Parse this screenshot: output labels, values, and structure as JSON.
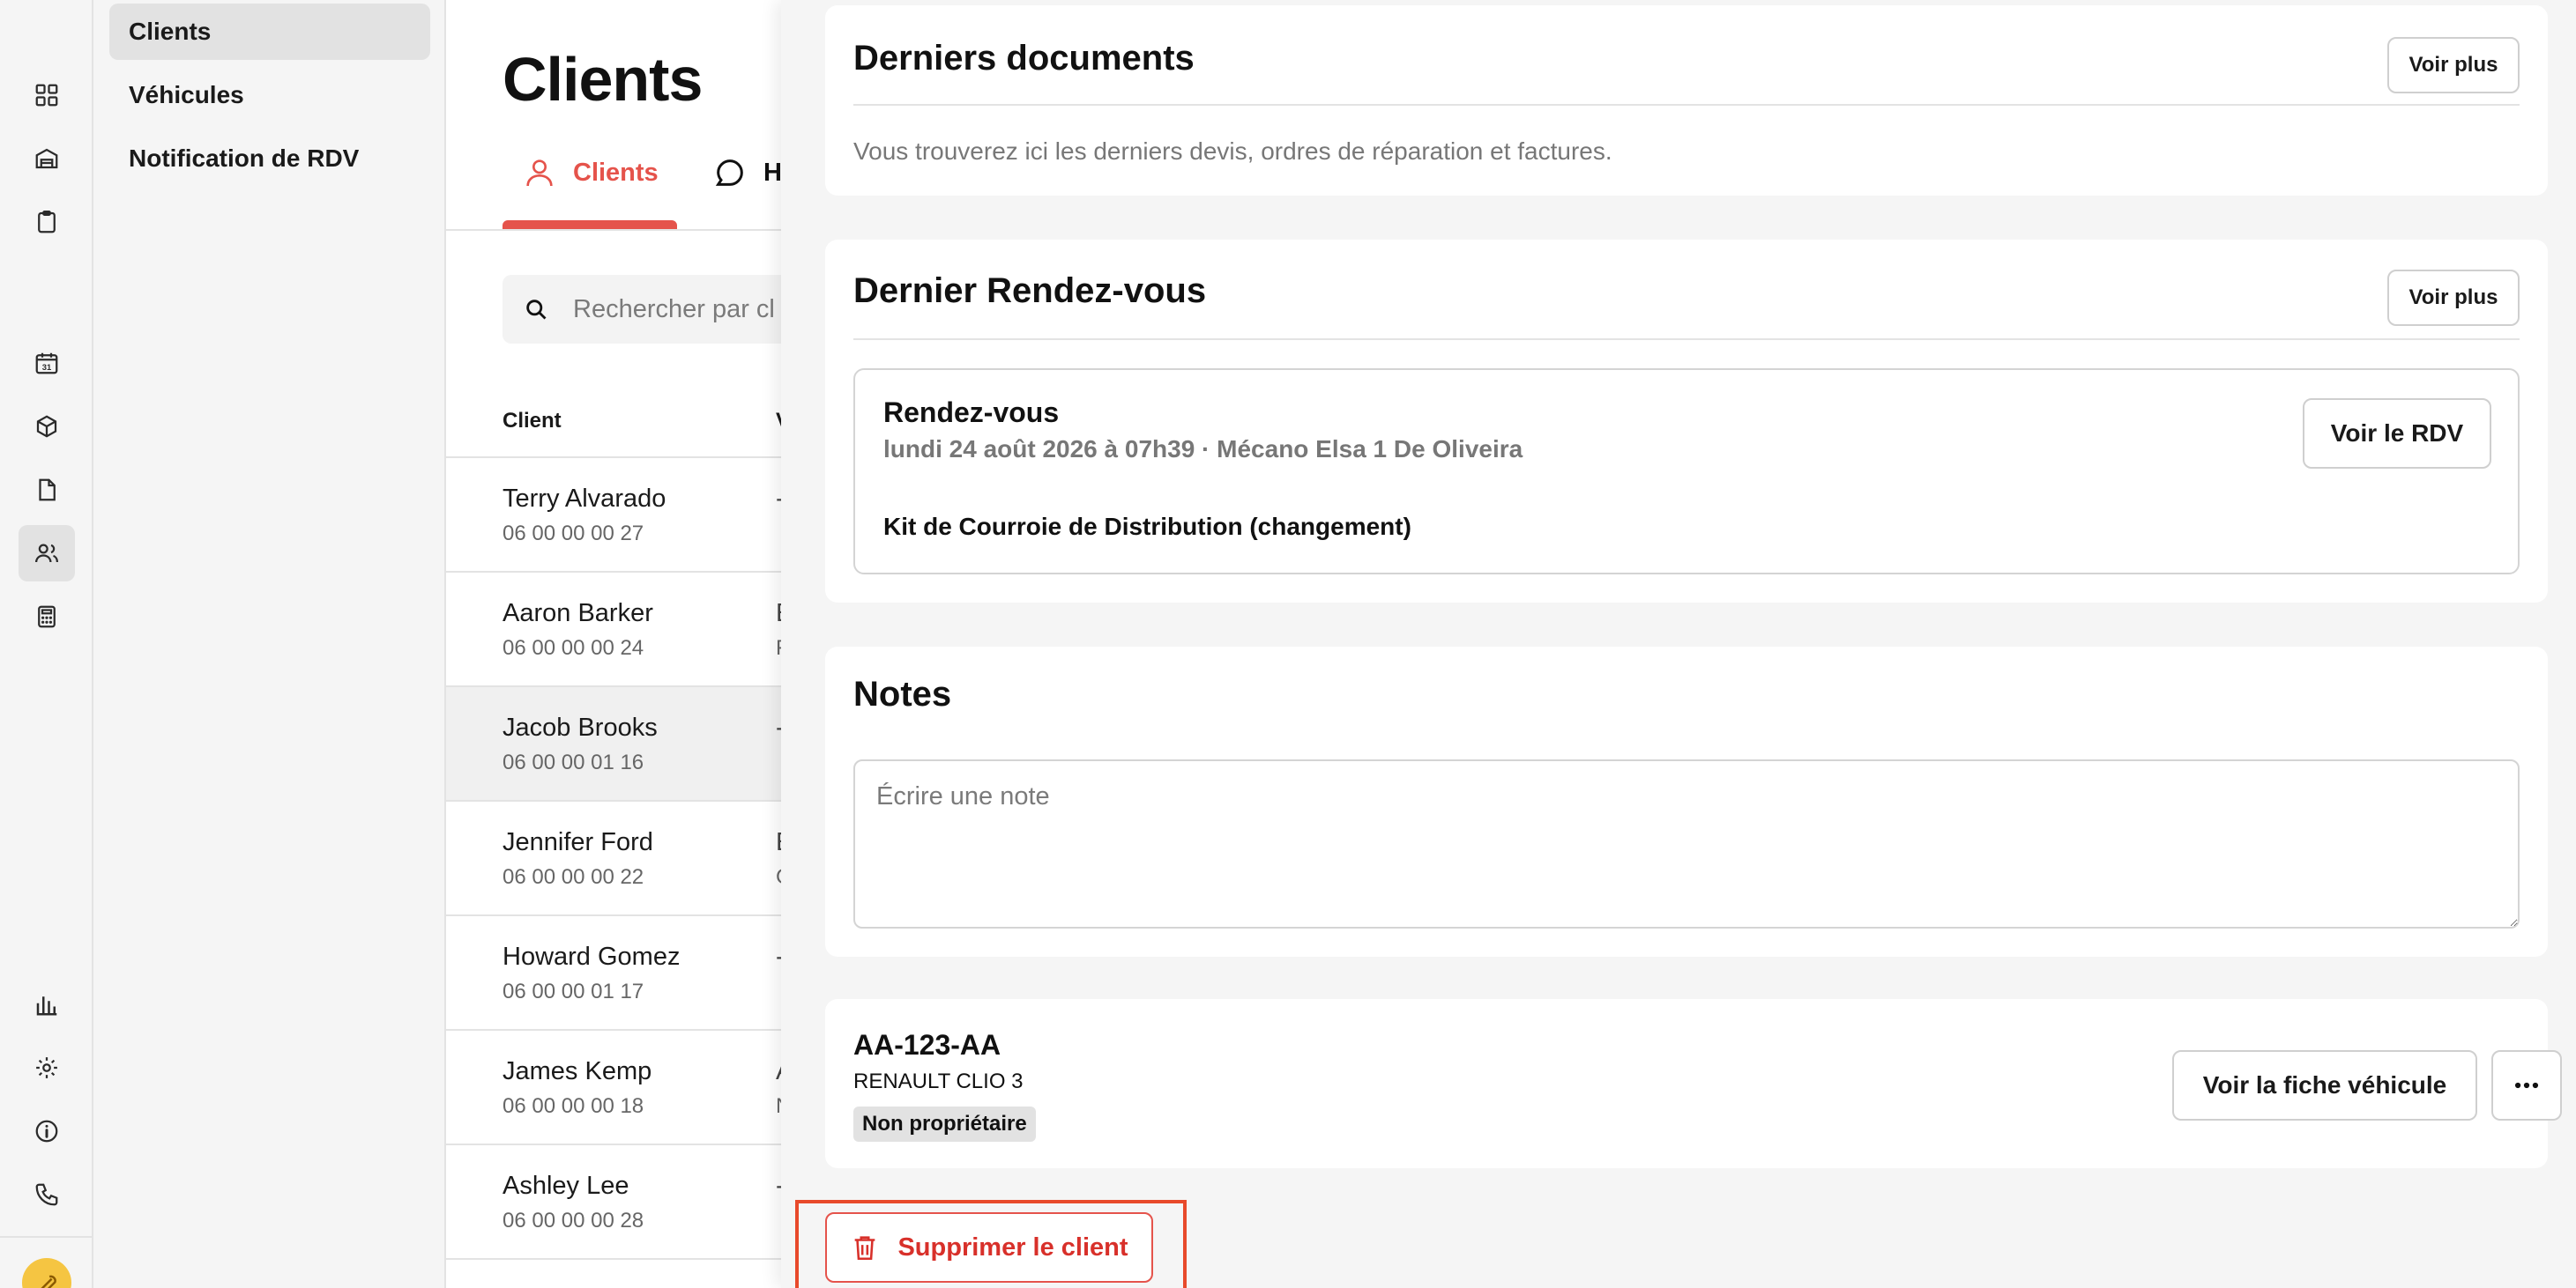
{
  "subnav": {
    "items": [
      {
        "label": "Clients",
        "active": true
      },
      {
        "label": "Véhicules",
        "active": false
      },
      {
        "label": "Notification de RDV",
        "active": false
      }
    ]
  },
  "rail": {
    "icons": [
      "dashboard-icon",
      "garage-icon",
      "clipboard-icon",
      "calendar-icon",
      "box-icon",
      "document-icon",
      "users-icon",
      "calculator-icon",
      "chart-icon",
      "gear-icon",
      "info-icon",
      "phone-icon",
      "wrench-avatar-icon"
    ],
    "active": "users-icon",
    "calendar_day": "31"
  },
  "list": {
    "title": "Clients",
    "tabs": [
      {
        "label": "Clients",
        "active": true
      },
      {
        "label": "Hi",
        "active": false
      }
    ],
    "search_placeholder": "Rechercher par cl",
    "columns": {
      "client": "Client",
      "vehicle": "V"
    },
    "rows": [
      {
        "name": "Terry Alvarado",
        "phone": "06 00 00 00 27",
        "vehicle": "-",
        "sub": ""
      },
      {
        "name": "Aaron Barker",
        "phone": "06 00 00 00 24",
        "vehicle": "E",
        "sub": "F"
      },
      {
        "name": "Jacob Brooks",
        "phone": "06 00 00 01 16",
        "vehicle": "-",
        "sub": "",
        "selected": true
      },
      {
        "name": "Jennifer Ford",
        "phone": "06 00 00 00 22",
        "vehicle": "E",
        "sub": "C"
      },
      {
        "name": "Howard Gomez",
        "phone": "06 00 00 01 17",
        "vehicle": "-",
        "sub": ""
      },
      {
        "name": "James Kemp",
        "phone": "06 00 00 00 18",
        "vehicle": "A",
        "sub": "N"
      },
      {
        "name": "Ashley Lee",
        "phone": "06 00 00 00 28",
        "vehicle": "-",
        "sub": ""
      }
    ]
  },
  "drawer": {
    "documents": {
      "title": "Derniers documents",
      "more_label": "Voir plus",
      "description": "Vous trouverez ici les derniers devis, ordres de réparation et factures."
    },
    "appointment": {
      "title": "Dernier Rendez-vous",
      "more_label": "Voir plus",
      "card_title": "Rendez-vous",
      "card_subtitle": "lundi 24 août 2026 à 07h39 · Mécano Elsa 1 De Oliveira",
      "service": "Kit de Courroie de Distribution (changement)",
      "view_label": "Voir le RDV"
    },
    "notes": {
      "title": "Notes",
      "placeholder": "Écrire une note",
      "value": ""
    },
    "vehicle": {
      "plate": "AA-123-AA",
      "model": "RENAULT CLIO 3",
      "badge": "Non propriétaire",
      "view_label": "Voir la fiche véhicule"
    },
    "delete_label": "Supprimer le client"
  },
  "colors": {
    "accent": "#e5534b",
    "danger": "#d8302a",
    "highlight": "#e84a2b"
  }
}
